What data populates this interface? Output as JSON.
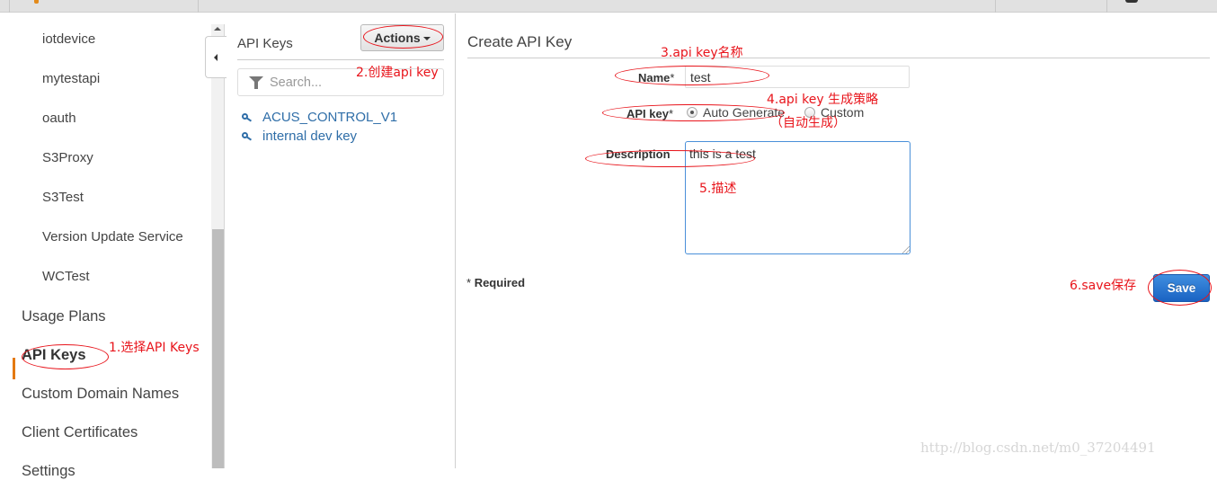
{
  "nav": {
    "api_items": [
      "iotdevice",
      "mytestapi",
      "oauth",
      "S3Proxy",
      "S3Test",
      "Version Update Service",
      "WCTest"
    ],
    "sections": [
      "Usage Plans",
      "API Keys",
      "Custom Domain Names",
      "Client Certificates",
      "Settings"
    ],
    "active_section": "API Keys"
  },
  "keys_panel": {
    "title": "API Keys",
    "actions_label": "Actions",
    "search_placeholder": "Search...",
    "keys": [
      "ACUS_CONTROL_V1",
      "internal dev key"
    ]
  },
  "form": {
    "title": "Create API Key",
    "name_label": "Name",
    "name_value": "test",
    "api_key_label": "API key",
    "required_marker": "*",
    "api_key_options": [
      {
        "label": "Auto Generate",
        "selected": true
      },
      {
        "label": "Custom",
        "selected": false
      }
    ],
    "description_label": "Description",
    "description_value": "this is a test",
    "required_note": "Required",
    "save_label": "Save"
  },
  "annotations": {
    "step1": "1.选择API Keys",
    "step2": "2.创建api key",
    "step3": "3.api key名称",
    "step4": "4.api key  生成策略",
    "step4_sub": "（自动生成）",
    "step5": "5.描述",
    "step6": "6.save保存",
    "color": "#e8141b"
  },
  "watermark": "http://blog.csdn.net/m0_37204491"
}
